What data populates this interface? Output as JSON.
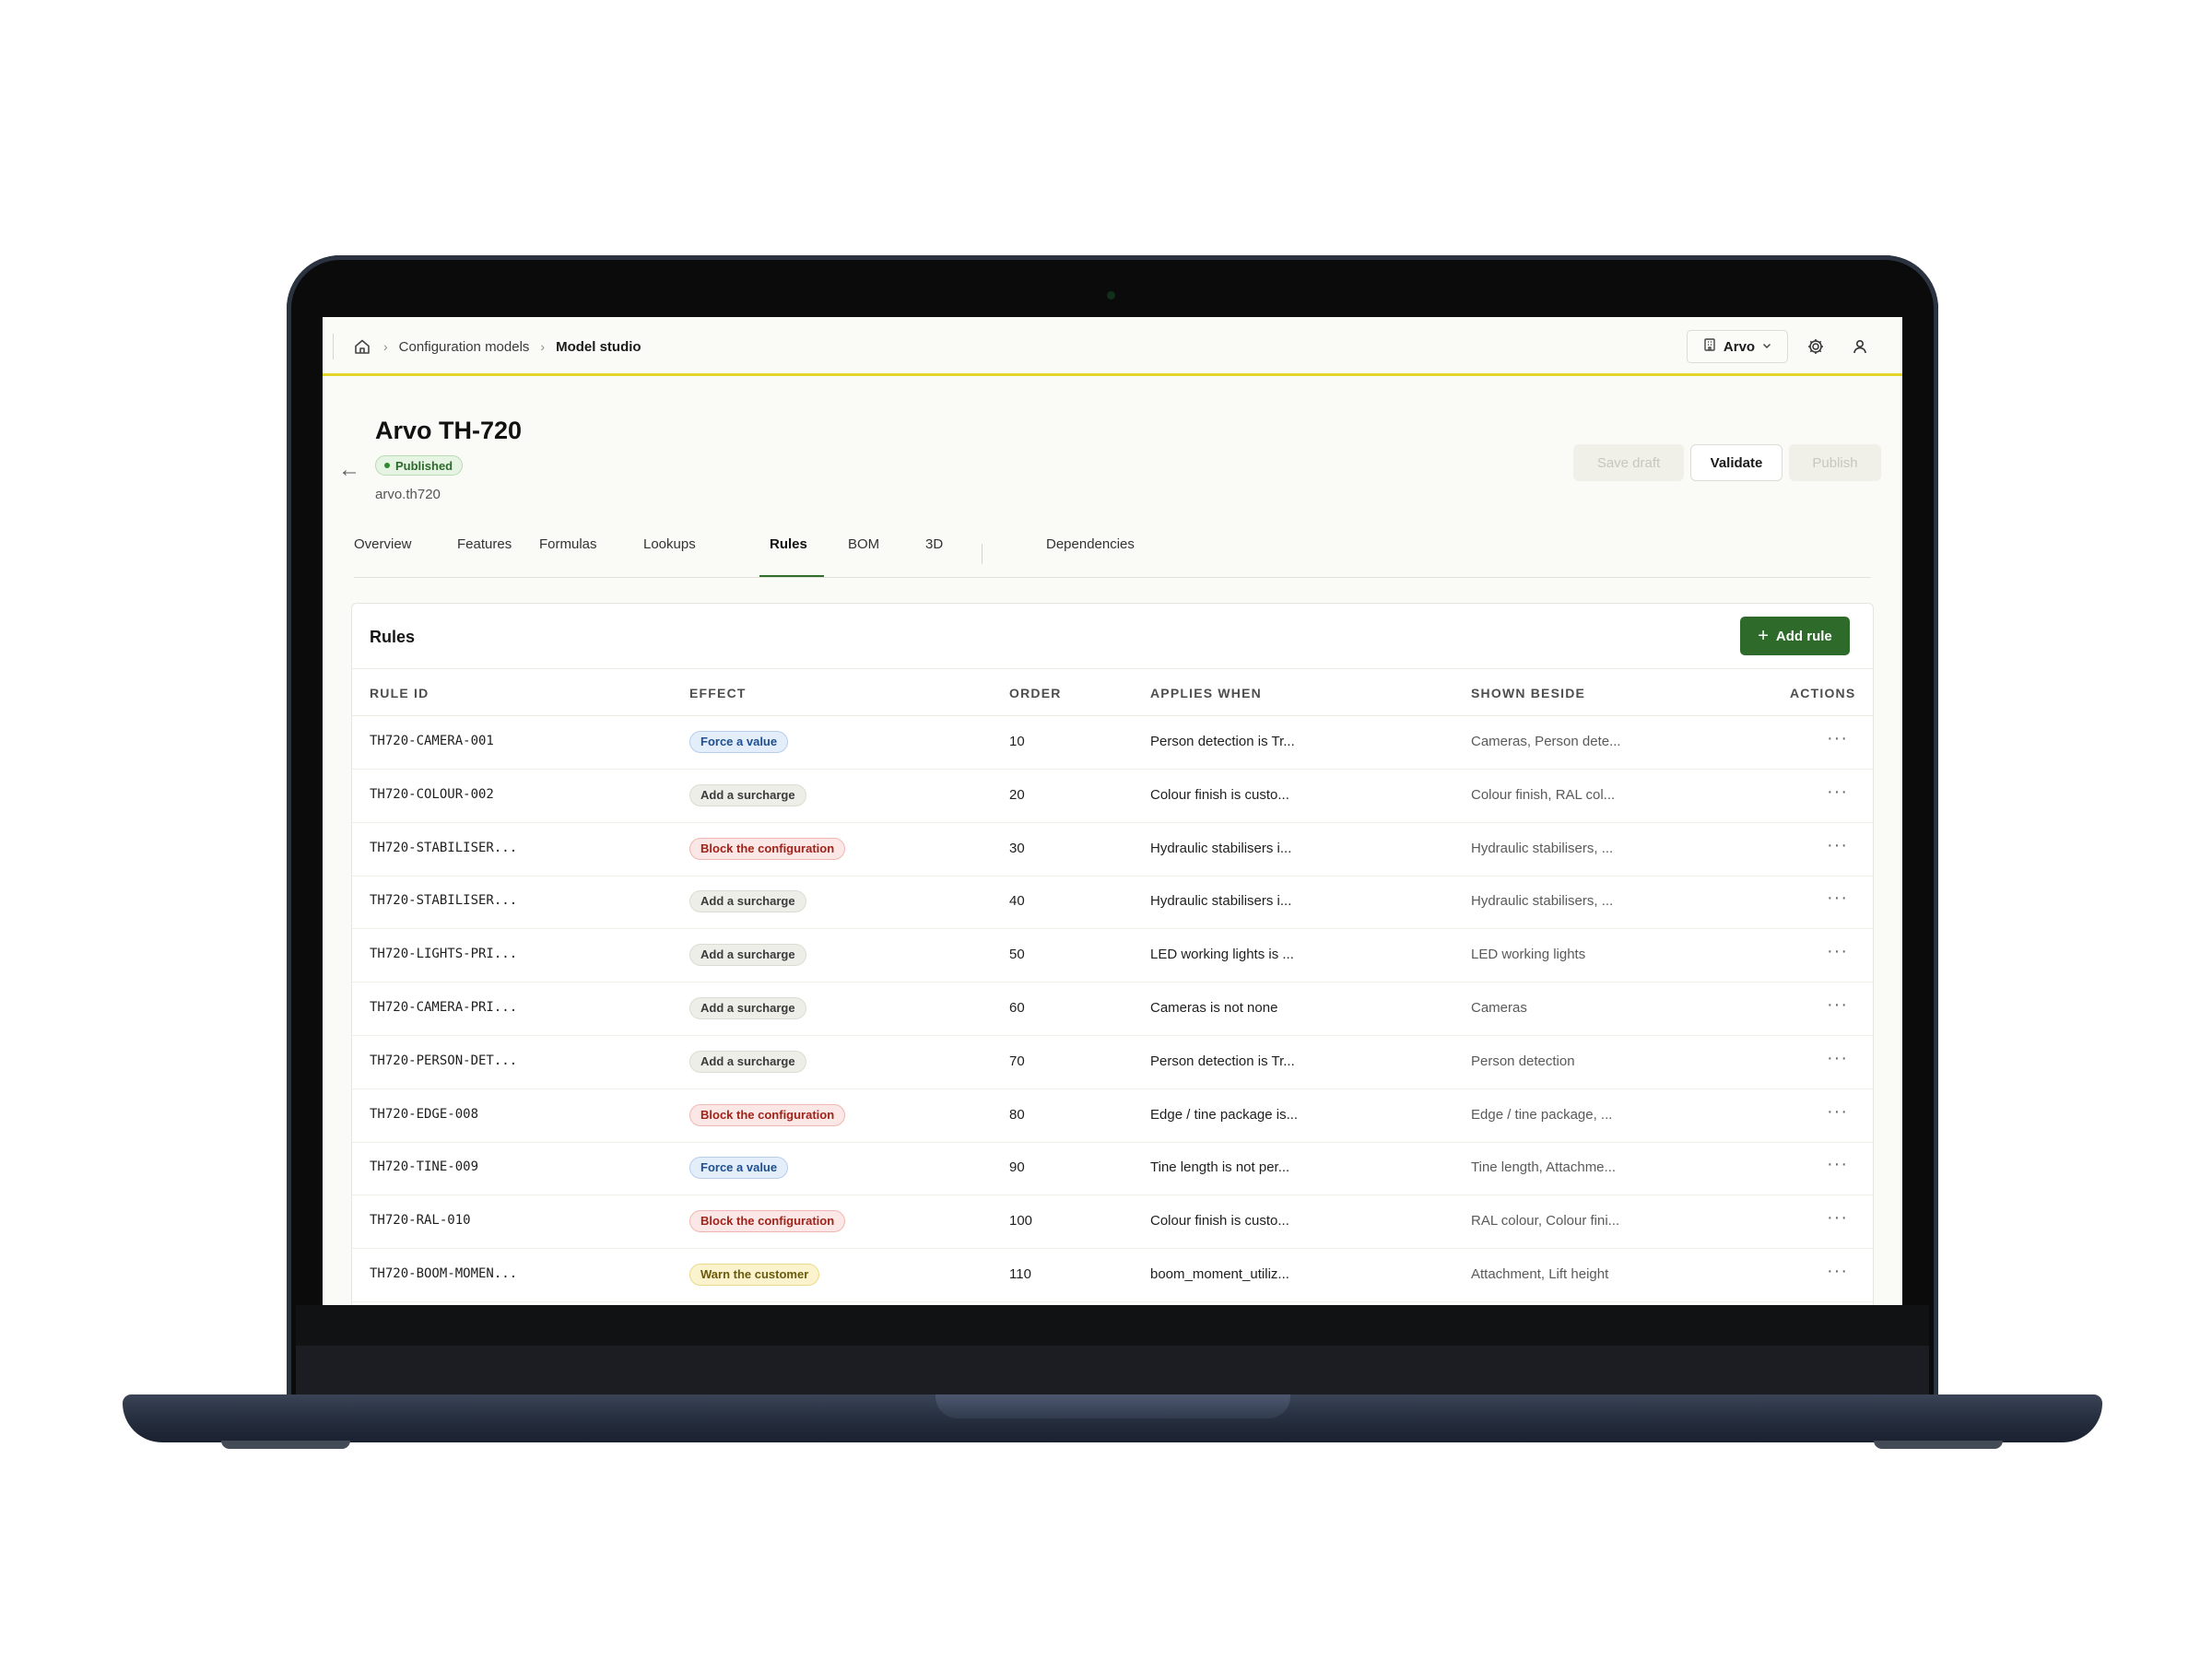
{
  "breadcrumb": {
    "items": [
      "Configuration models",
      "Model studio"
    ]
  },
  "header": {
    "tenant": "Arvo"
  },
  "model": {
    "title": "Arvo TH-720",
    "status": "Published",
    "slug": "arvo.th720"
  },
  "toolbar": {
    "save_draft": "Save draft",
    "validate": "Validate",
    "publish": "Publish"
  },
  "tabs": [
    {
      "label": "Overview",
      "active": false
    },
    {
      "label": "Features",
      "active": false
    },
    {
      "label": "Formulas",
      "active": false
    },
    {
      "label": "Lookups",
      "active": false
    },
    {
      "label": "Rules",
      "active": true
    },
    {
      "label": "BOM",
      "active": false
    },
    {
      "label": "3D",
      "active": false
    },
    {
      "label": "Dependencies",
      "active": false
    }
  ],
  "rules": {
    "title": "Rules",
    "add_label": "Add rule",
    "columns": [
      "RULE ID",
      "EFFECT",
      "ORDER",
      "APPLIES WHEN",
      "SHOWN BESIDE",
      "ACTIONS"
    ],
    "rows": [
      {
        "id": "TH720-CAMERA-001",
        "effect": "Force a value",
        "effect_tone": "blue",
        "order": "10",
        "applies": "Person detection is Tr...",
        "beside": "Cameras, Person dete..."
      },
      {
        "id": "TH720-COLOUR-002",
        "effect": "Add a surcharge",
        "effect_tone": "gray",
        "order": "20",
        "applies": "Colour finish is custo...",
        "beside": "Colour finish, RAL col..."
      },
      {
        "id": "TH720-STABILISER...",
        "effect": "Block the configuration",
        "effect_tone": "red",
        "order": "30",
        "applies": "Hydraulic stabilisers i...",
        "beside": "Hydraulic stabilisers, ..."
      },
      {
        "id": "TH720-STABILISER...",
        "effect": "Add a surcharge",
        "effect_tone": "gray",
        "order": "40",
        "applies": "Hydraulic stabilisers i...",
        "beside": "Hydraulic stabilisers, ..."
      },
      {
        "id": "TH720-LIGHTS-PRI...",
        "effect": "Add a surcharge",
        "effect_tone": "gray",
        "order": "50",
        "applies": "LED working lights is ...",
        "beside": "LED working lights"
      },
      {
        "id": "TH720-CAMERA-PRI...",
        "effect": "Add a surcharge",
        "effect_tone": "gray",
        "order": "60",
        "applies": "Cameras is not none",
        "beside": "Cameras"
      },
      {
        "id": "TH720-PERSON-DET...",
        "effect": "Add a surcharge",
        "effect_tone": "gray",
        "order": "70",
        "applies": "Person detection is Tr...",
        "beside": "Person detection"
      },
      {
        "id": "TH720-EDGE-008",
        "effect": "Block the configuration",
        "effect_tone": "red",
        "order": "80",
        "applies": "Edge / tine package is...",
        "beside": "Edge / tine package, ..."
      },
      {
        "id": "TH720-TINE-009",
        "effect": "Force a value",
        "effect_tone": "blue",
        "order": "90",
        "applies": "Tine length is not per...",
        "beside": "Tine length, Attachme..."
      },
      {
        "id": "TH720-RAL-010",
        "effect": "Block the configuration",
        "effect_tone": "red",
        "order": "100",
        "applies": "Colour finish is custo...",
        "beside": "RAL colour, Colour fini..."
      },
      {
        "id": "TH720-BOOM-MOMEN...",
        "effect": "Warn the customer",
        "effect_tone": "yellow",
        "order": "110",
        "applies": "boom_moment_utiliz...",
        "beside": "Attachment, Lift height"
      }
    ],
    "more_glyph": "···"
  },
  "colors": {
    "accent_line": "#e3d62a",
    "primary_button": "#2e6b2a",
    "status_green": "#2f8a2e"
  }
}
